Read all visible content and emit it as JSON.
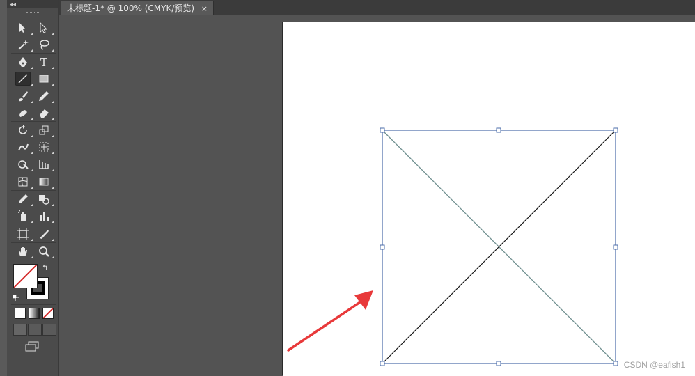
{
  "panel": {
    "collapse_glyph": "◂◂"
  },
  "tabs": [
    {
      "title": "未标题-1* @ 100% (CMYK/预览)",
      "close_glyph": "×"
    }
  ],
  "tools": [
    {
      "name": "selection-tool-icon"
    },
    {
      "name": "direct-selection-tool-icon"
    },
    {
      "name": "magic-wand-tool-icon"
    },
    {
      "name": "lasso-tool-icon"
    },
    {
      "name": "pen-tool-icon"
    },
    {
      "name": "type-tool-icon",
      "glyph": "T"
    },
    {
      "name": "line-segment-tool-icon",
      "active": true
    },
    {
      "name": "rectangle-tool-icon"
    },
    {
      "name": "paintbrush-tool-icon"
    },
    {
      "name": "pencil-tool-icon"
    },
    {
      "name": "blob-brush-tool-icon"
    },
    {
      "name": "eraser-tool-icon"
    },
    {
      "name": "rotate-tool-icon"
    },
    {
      "name": "scale-tool-icon"
    },
    {
      "name": "warp-tool-icon"
    },
    {
      "name": "free-transform-tool-icon"
    },
    {
      "name": "shape-builder-tool-icon"
    },
    {
      "name": "perspective-grid-tool-icon"
    },
    {
      "name": "mesh-tool-icon"
    },
    {
      "name": "gradient-tool-icon"
    },
    {
      "name": "eyedropper-tool-icon"
    },
    {
      "name": "blend-tool-icon"
    },
    {
      "name": "symbol-sprayer-tool-icon"
    },
    {
      "name": "column-graph-tool-icon"
    },
    {
      "name": "artboard-tool-icon"
    },
    {
      "name": "slice-tool-icon"
    },
    {
      "name": "hand-tool-icon"
    },
    {
      "name": "zoom-tool-icon"
    }
  ],
  "colors": {
    "fill": "none",
    "stroke": "#000000",
    "panel_bg": "#4b4b4b",
    "canvas_bg": "#535353",
    "artboard_bg": "#ffffff",
    "selection_color": "#4a6ba8",
    "arrow_color": "#e8393a"
  },
  "watermark": "CSDN @eafish1"
}
